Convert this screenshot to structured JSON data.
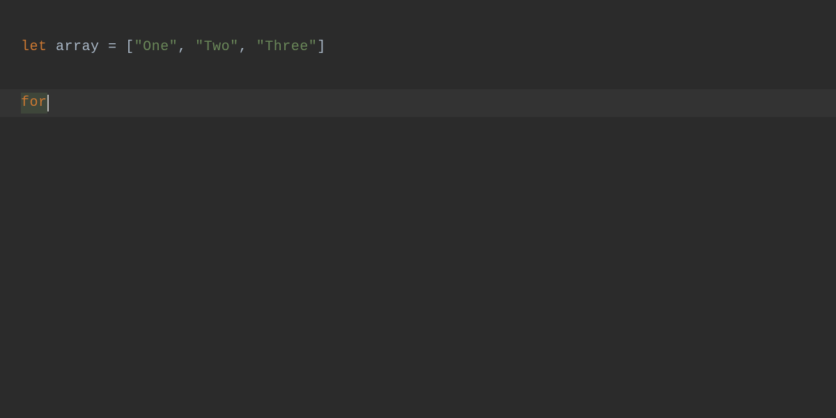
{
  "code": {
    "line1": {
      "kw_let": "let",
      "ident": "array",
      "eq": "=",
      "lbracket": "[",
      "str1": "\"One\"",
      "comma1": ",",
      "str2": "\"Two\"",
      "comma2": ",",
      "str3": "\"Three\"",
      "rbracket": "]"
    },
    "line3": {
      "typed": "for"
    }
  }
}
